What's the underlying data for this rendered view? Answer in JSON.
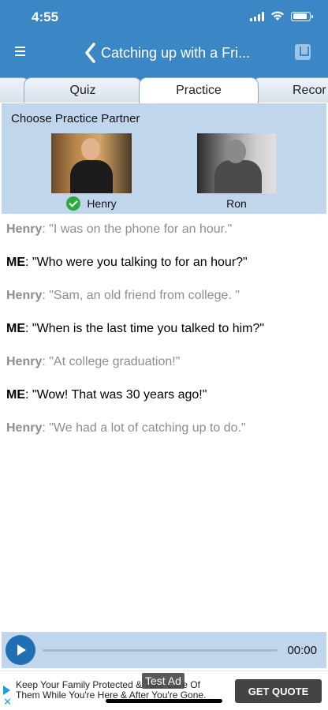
{
  "status_bar": {
    "time": "4:55"
  },
  "nav": {
    "title": "Catching up with a Fri..."
  },
  "tabs": [
    {
      "label": "Quiz"
    },
    {
      "label": "Practice"
    },
    {
      "label": "Recor"
    }
  ],
  "partner_panel": {
    "title": "Choose Practice Partner",
    "partners": [
      {
        "name": "Henry",
        "selected": true
      },
      {
        "name": "Ron",
        "selected": false
      }
    ]
  },
  "dialogue": [
    {
      "speaker": "Henry",
      "text": ": \"I was on the phone for an hour.\""
    },
    {
      "speaker": "ME",
      "text": ": \"Who were you talking to for an hour?\""
    },
    {
      "speaker": "Henry",
      "text": ": \"Sam, an old friend from college. \""
    },
    {
      "speaker": "ME",
      "text": ": \"When is the last time you talked to him?\""
    },
    {
      "speaker": "Henry",
      "text": ": \"At college graduation!\""
    },
    {
      "speaker": "ME",
      "text": ": \"Wow! That was 30 years ago!\""
    },
    {
      "speaker": "Henry",
      "text": ": \"We had a lot of catching up to do.\""
    }
  ],
  "player": {
    "time": "00:00",
    "progress": 0
  },
  "ad": {
    "label": "Test Ad",
    "text": "Keep Your Family Protected & Take Care Of Them While You're Here & After You're Gone.",
    "cta": "GET QUOTE"
  },
  "colors": {
    "header": "#3b86c4",
    "panel": "#bfd6ec",
    "other_speaker_text": "#8e8e8e",
    "play_button": "#1f6fb4",
    "selected_check": "#2eaa3c"
  }
}
